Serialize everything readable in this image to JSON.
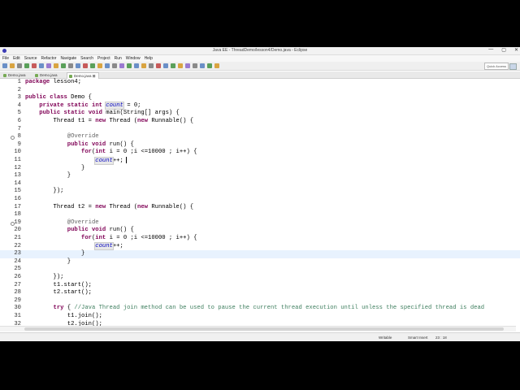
{
  "window": {
    "title": "Java EE - ThreadDemo/lesson4/Demo.java - Eclipse",
    "controls": [
      "—",
      "▢",
      "✕"
    ]
  },
  "menu": [
    "File",
    "Edit",
    "Source",
    "Refactor",
    "Navigate",
    "Search",
    "Project",
    "Run",
    "Window",
    "Help"
  ],
  "quick_access": "Quick Access",
  "tabs": [
    {
      "label": "Demo.java",
      "active": false
    },
    {
      "label": "Demo.java",
      "active": false
    },
    {
      "label": "Demo.java ⊠",
      "active": true
    }
  ],
  "code_lines": [
    {
      "n": "1",
      "html": "<span class='kw'>package</span> lesson4;"
    },
    {
      "n": "2",
      "html": ""
    },
    {
      "n": "3",
      "html": "<span class='kw'>public</span> <span class='kw'>class</span> Demo {"
    },
    {
      "n": "4",
      "html": "    <span class='kw'>private</span> <span class='kw'>static</span> <span class='kw'>int</span> <span class='fld mark'>count</span> = 0;"
    },
    {
      "n": "5",
      "html": "    <span class='kw'>public</span> <span class='kw'>static</span> <span class='kw'>void</span> main(String[] args) {"
    },
    {
      "n": "6",
      "html": "        Thread t1 = <span class='kw'>new</span> Thread (<span class='kw'>new</span> Runnable() {"
    },
    {
      "n": "7",
      "html": ""
    },
    {
      "n": "8",
      "html": "            <span class='ann'>@Override</span>",
      "fold": true
    },
    {
      "n": "9",
      "html": "            <span class='kw'>public</span> <span class='kw'>void</span> run() {"
    },
    {
      "n": "10",
      "html": "                <span class='kw'>for</span>(<span class='kw'>int</span> i = 0 ;i &lt;=10000 ; i++) {"
    },
    {
      "n": "11",
      "html": "                    <span class='fld mark'>count</span>++;<span class='cursor'></span>"
    },
    {
      "n": "12",
      "html": "                }"
    },
    {
      "n": "13",
      "html": "            }"
    },
    {
      "n": "14",
      "html": ""
    },
    {
      "n": "15",
      "html": "        });"
    },
    {
      "n": "16",
      "html": ""
    },
    {
      "n": "17",
      "html": "        Thread t2 = <span class='kw'>new</span> Thread (<span class='kw'>new</span> Runnable() {"
    },
    {
      "n": "18",
      "html": ""
    },
    {
      "n": "19",
      "html": "            <span class='ann'>@Override</span>",
      "fold": true
    },
    {
      "n": "20",
      "html": "            <span class='kw'>public</span> <span class='kw'>void</span> run() {"
    },
    {
      "n": "21",
      "html": "                <span class='kw'>for</span>(<span class='kw'>int</span> i = 0 ;i &lt;=10000 ; i++) {"
    },
    {
      "n": "22",
      "html": "                    <span class='fld mark'>count</span>++;"
    },
    {
      "n": "23",
      "html": "                }",
      "hl": true
    },
    {
      "n": "24",
      "html": "            }"
    },
    {
      "n": "25",
      "html": ""
    },
    {
      "n": "26",
      "html": "        });"
    },
    {
      "n": "27",
      "html": "        t1.start();"
    },
    {
      "n": "28",
      "html": "        t2.start();"
    },
    {
      "n": "29",
      "html": ""
    },
    {
      "n": "30",
      "html": "        <span class='kw'>try</span> { <span class='cmt'>//Java Thread join method can be used to pause the current thread execution until unless the specified thread is dead</span>"
    },
    {
      "n": "31",
      "html": "            t1.join();"
    },
    {
      "n": "32",
      "html": "            t2.join();"
    }
  ],
  "status": {
    "mode": "Writable",
    "insert": "Smart Insert",
    "position": "23 : 18"
  }
}
